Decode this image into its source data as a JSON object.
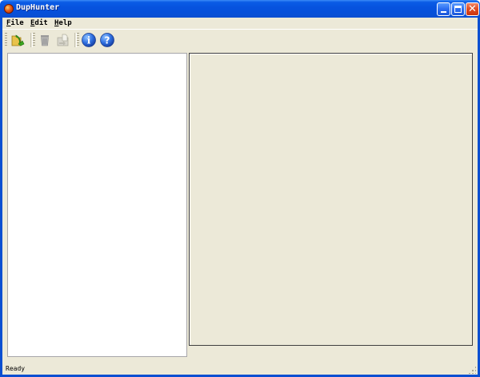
{
  "window": {
    "title": "DupHunter",
    "app_icon": "duphunter-app-icon",
    "controls": {
      "minimize_icon": "minimize-icon",
      "maximize_icon": "maximize-icon",
      "close_icon": "close-icon",
      "close_glyph": "✕"
    },
    "title_color": "#0a4fd1"
  },
  "menubar": {
    "items": [
      {
        "hotkey": "F",
        "rest": "ile"
      },
      {
        "hotkey": "E",
        "rest": "dit"
      },
      {
        "hotkey": "H",
        "rest": "elp"
      }
    ]
  },
  "toolbar": {
    "buttons": [
      {
        "icon": "open-folder-icon",
        "enabled": true
      },
      {
        "icon": "trash-icon",
        "enabled": false
      },
      {
        "icon": "move-file-icon",
        "enabled": false
      },
      {
        "icon": "info-icon",
        "glyph": "i",
        "enabled": true
      },
      {
        "icon": "help-icon",
        "glyph": "?",
        "enabled": true
      }
    ]
  },
  "status": {
    "text": "Ready"
  }
}
